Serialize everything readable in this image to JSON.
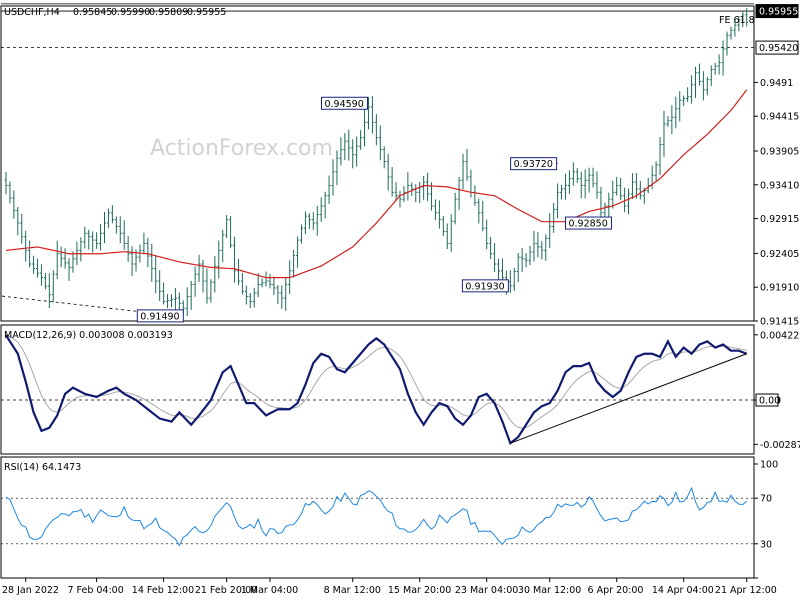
{
  "chart_data": [
    {
      "type": "candlestick",
      "header": {
        "symbol": "USDCHF,H4",
        "open": "0.95845",
        "high": "0.95990",
        "low": "0.95809",
        "close": "0.95955"
      },
      "watermark": "ActionForex.com",
      "y_axis": {
        "ylim": [
          0.91415,
          0.96
        ],
        "ticks": [
          "0.9491",
          "0.94415",
          "0.93905",
          "0.93410",
          "0.92915",
          "0.92405",
          "0.91910",
          "0.91415"
        ],
        "tick_values": [
          0.9491,
          0.94415,
          0.93905,
          0.9341,
          0.92915,
          0.92405,
          0.9191,
          0.91415
        ],
        "last_price_label": "0.95955",
        "last_price": 0.95955,
        "level_label": "0.95420",
        "level": 0.9542
      },
      "fib_label": "FE 61.8",
      "fib_level": 0.9606,
      "price_labels": [
        {
          "text": "0.94590",
          "value": 0.9459,
          "bar": 92
        },
        {
          "text": "0.93720",
          "value": 0.9372,
          "bar": 140
        },
        {
          "text": "0.92850",
          "value": 0.9285,
          "bar": 142
        },
        {
          "text": "0.91930",
          "value": 0.9193,
          "bar": 127
        },
        {
          "text": "0.91490",
          "value": 0.9149,
          "bar": 45
        }
      ],
      "keypoints": [
        [
          0,
          0.934
        ],
        [
          3,
          0.9285
        ],
        [
          6,
          0.9225
        ],
        [
          9,
          0.9205
        ],
        [
          11,
          0.918
        ],
        [
          13,
          0.924
        ],
        [
          16,
          0.922
        ],
        [
          20,
          0.927
        ],
        [
          23,
          0.9255
        ],
        [
          26,
          0.93
        ],
        [
          29,
          0.927
        ],
        [
          32,
          0.9225
        ],
        [
          35,
          0.9255
        ],
        [
          38,
          0.92
        ],
        [
          40,
          0.917
        ],
        [
          43,
          0.9175
        ],
        [
          45,
          0.916
        ],
        [
          47,
          0.9195
        ],
        [
          49,
          0.9225
        ],
        [
          51,
          0.9175
        ],
        [
          54,
          0.9245
        ],
        [
          56,
          0.929
        ],
        [
          58,
          0.9215
        ],
        [
          60,
          0.9185
        ],
        [
          62,
          0.917
        ],
        [
          64,
          0.9195
        ],
        [
          66,
          0.92
        ],
        [
          68,
          0.919
        ],
        [
          70,
          0.9175
        ],
        [
          72,
          0.9215
        ],
        [
          74,
          0.926
        ],
        [
          76,
          0.9295
        ],
        [
          78,
          0.9285
        ],
        [
          80,
          0.931
        ],
        [
          82,
          0.934
        ],
        [
          84,
          0.938
        ],
        [
          86,
          0.9405
        ],
        [
          88,
          0.9385
        ],
        [
          90,
          0.941
        ],
        [
          92,
          0.9455
        ],
        [
          94,
          0.941
        ],
        [
          96,
          0.9375
        ],
        [
          98,
          0.933
        ],
        [
          100,
          0.932
        ],
        [
          102,
          0.934
        ],
        [
          104,
          0.933
        ],
        [
          106,
          0.9345
        ],
        [
          108,
          0.931
        ],
        [
          110,
          0.929
        ],
        [
          112,
          0.9255
        ],
        [
          114,
          0.932
        ],
        [
          116,
          0.9375
        ],
        [
          118,
          0.933
        ],
        [
          120,
          0.93
        ],
        [
          122,
          0.9255
        ],
        [
          124,
          0.9225
        ],
        [
          126,
          0.9205
        ],
        [
          128,
          0.9193
        ],
        [
          130,
          0.9235
        ],
        [
          132,
          0.923
        ],
        [
          134,
          0.9255
        ],
        [
          136,
          0.9245
        ],
        [
          138,
          0.928
        ],
        [
          140,
          0.933
        ],
        [
          142,
          0.934
        ],
        [
          144,
          0.936
        ],
        [
          146,
          0.934
        ],
        [
          148,
          0.9355
        ],
        [
          150,
          0.933
        ],
        [
          151,
          0.93
        ],
        [
          153,
          0.932
        ],
        [
          155,
          0.934
        ],
        [
          157,
          0.931
        ],
        [
          159,
          0.9345
        ],
        [
          161,
          0.9325
        ],
        [
          163,
          0.934
        ],
        [
          165,
          0.937
        ],
        [
          167,
          0.943
        ],
        [
          169,
          0.944
        ],
        [
          171,
          0.9465
        ],
        [
          173,
          0.947
        ],
        [
          175,
          0.9505
        ],
        [
          177,
          0.948
        ],
        [
          179,
          0.951
        ],
        [
          181,
          0.952
        ],
        [
          183,
          0.956
        ],
        [
          185,
          0.9575
        ],
        [
          187,
          0.959
        ],
        [
          188,
          0.95955
        ]
      ],
      "ma_keypoints": [
        [
          0,
          0.9245
        ],
        [
          8,
          0.925
        ],
        [
          16,
          0.924
        ],
        [
          24,
          0.924
        ],
        [
          30,
          0.9243
        ],
        [
          36,
          0.924
        ],
        [
          44,
          0.9228
        ],
        [
          52,
          0.922
        ],
        [
          58,
          0.9218
        ],
        [
          66,
          0.9205
        ],
        [
          72,
          0.9205
        ],
        [
          80,
          0.9222
        ],
        [
          88,
          0.925
        ],
        [
          94,
          0.9285
        ],
        [
          100,
          0.9325
        ],
        [
          106,
          0.934
        ],
        [
          112,
          0.9338
        ],
        [
          118,
          0.933
        ],
        [
          124,
          0.9325
        ],
        [
          130,
          0.9305
        ],
        [
          136,
          0.9287
        ],
        [
          142,
          0.9287
        ],
        [
          148,
          0.9302
        ],
        [
          154,
          0.931
        ],
        [
          160,
          0.9325
        ],
        [
          166,
          0.935
        ],
        [
          172,
          0.9385
        ],
        [
          178,
          0.9415
        ],
        [
          184,
          0.945
        ],
        [
          188,
          0.948
        ]
      ],
      "x_axis": {
        "labels": [
          "28 Jan 2022",
          "7 Feb 04:00",
          "14 Feb 12:00",
          "21 Feb 20:00",
          "1 Mar 04:00",
          "8 Mar 12:00",
          "15 Mar 20:00",
          "23 Mar 04:00",
          "30 Mar 12:00",
          "6 Apr 20:00",
          "14 Apr 04:00",
          "21 Apr 12:00"
        ],
        "label_bars": [
          5,
          23,
          40,
          56,
          67,
          88,
          105,
          122,
          138,
          155,
          172,
          188
        ]
      }
    },
    {
      "type": "line",
      "title": "MACD(12,26,9) 0.003008 0.003193",
      "y_axis": {
        "ylim": [
          -0.0035,
          0.0048
        ],
        "ticks": [
          "0.004229",
          "0.00",
          "-0.002874"
        ],
        "tick_values": [
          0.004229,
          0.0,
          -0.002874
        ],
        "current_label": "0.00",
        "current_value": 0.0
      },
      "keypoints": [
        [
          0,
          0.0042
        ],
        [
          3,
          0.003
        ],
        [
          5,
          0.0012
        ],
        [
          7,
          -0.0008
        ],
        [
          9,
          -0.002
        ],
        [
          11,
          -0.0018
        ],
        [
          13,
          -0.001
        ],
        [
          15,
          0.0004
        ],
        [
          17,
          0.0008
        ],
        [
          20,
          0.0004
        ],
        [
          23,
          0.0002
        ],
        [
          26,
          0.0006
        ],
        [
          28,
          0.0008
        ],
        [
          30,
          0.0004
        ],
        [
          33,
          0.0
        ],
        [
          36,
          -0.0006
        ],
        [
          39,
          -0.0012
        ],
        [
          42,
          -0.0014
        ],
        [
          44,
          -0.0008
        ],
        [
          47,
          -0.0016
        ],
        [
          49,
          -0.001
        ],
        [
          52,
          0.0
        ],
        [
          55,
          0.0018
        ],
        [
          57,
          0.0022
        ],
        [
          59,
          0.001
        ],
        [
          61,
          -0.0002
        ],
        [
          63,
          -0.0002
        ],
        [
          66,
          -0.001
        ],
        [
          69,
          -0.0006
        ],
        [
          72,
          -0.0006
        ],
        [
          74,
          -0.0002
        ],
        [
          76,
          0.001
        ],
        [
          78,
          0.0024
        ],
        [
          80,
          0.003
        ],
        [
          82,
          0.0028
        ],
        [
          84,
          0.002
        ],
        [
          86,
          0.0018
        ],
        [
          88,
          0.0024
        ],
        [
          90,
          0.003
        ],
        [
          92,
          0.0036
        ],
        [
          94,
          0.004
        ],
        [
          96,
          0.0036
        ],
        [
          98,
          0.0028
        ],
        [
          100,
          0.002
        ],
        [
          102,
          0.0004
        ],
        [
          104,
          -0.0008
        ],
        [
          106,
          -0.0016
        ],
        [
          108,
          -0.0008
        ],
        [
          110,
          -0.0002
        ],
        [
          112,
          -0.0004
        ],
        [
          114,
          -0.0012
        ],
        [
          116,
          -0.0016
        ],
        [
          118,
          -0.001
        ],
        [
          120,
          0.0002
        ],
        [
          122,
          0.0004
        ],
        [
          124,
          -0.0002
        ],
        [
          126,
          -0.0014
        ],
        [
          128,
          -0.0028
        ],
        [
          130,
          -0.0024
        ],
        [
          132,
          -0.0016
        ],
        [
          134,
          -0.0008
        ],
        [
          136,
          -0.0004
        ],
        [
          138,
          -0.0002
        ],
        [
          140,
          0.0006
        ],
        [
          142,
          0.0018
        ],
        [
          144,
          0.0022
        ],
        [
          146,
          0.0022
        ],
        [
          148,
          0.0024
        ],
        [
          150,
          0.0012
        ],
        [
          152,
          0.0006
        ],
        [
          154,
          0.0002
        ],
        [
          156,
          0.0006
        ],
        [
          158,
          0.0018
        ],
        [
          160,
          0.0028
        ],
        [
          162,
          0.003
        ],
        [
          164,
          0.003
        ],
        [
          166,
          0.0028
        ],
        [
          168,
          0.0038
        ],
        [
          170,
          0.0028
        ],
        [
          172,
          0.0034
        ],
        [
          174,
          0.003
        ],
        [
          176,
          0.0036
        ],
        [
          178,
          0.0038
        ],
        [
          180,
          0.0034
        ],
        [
          182,
          0.0036
        ],
        [
          184,
          0.0032
        ],
        [
          186,
          0.0032
        ],
        [
          188,
          0.003
        ]
      ],
      "trendline": {
        "from": [
          128,
          -0.0028
        ],
        "to": [
          188,
          0.003
        ]
      }
    },
    {
      "type": "line",
      "title": "RSI(14) 64.1473",
      "y_axis": {
        "ylim": [
          0,
          100
        ],
        "ticks": [
          "100",
          "70",
          "30",
          "0"
        ],
        "tick_values": [
          100,
          70,
          30,
          0
        ]
      },
      "keypoints": [
        [
          0,
          70
        ],
        [
          2,
          62
        ],
        [
          4,
          48
        ],
        [
          6,
          38
        ],
        [
          8,
          32
        ],
        [
          10,
          42
        ],
        [
          12,
          48
        ],
        [
          14,
          58
        ],
        [
          16,
          55
        ],
        [
          18,
          60
        ],
        [
          20,
          56
        ],
        [
          22,
          52
        ],
        [
          24,
          60
        ],
        [
          26,
          54
        ],
        [
          28,
          52
        ],
        [
          30,
          60
        ],
        [
          32,
          54
        ],
        [
          34,
          48
        ],
        [
          36,
          44
        ],
        [
          38,
          50
        ],
        [
          40,
          40
        ],
        [
          42,
          36
        ],
        [
          44,
          30
        ],
        [
          46,
          36
        ],
        [
          48,
          44
        ],
        [
          50,
          38
        ],
        [
          52,
          48
        ],
        [
          54,
          60
        ],
        [
          56,
          66
        ],
        [
          58,
          54
        ],
        [
          60,
          42
        ],
        [
          62,
          44
        ],
        [
          64,
          50
        ],
        [
          66,
          38
        ],
        [
          68,
          44
        ],
        [
          70,
          40
        ],
        [
          72,
          46
        ],
        [
          74,
          54
        ],
        [
          76,
          62
        ],
        [
          78,
          66
        ],
        [
          80,
          60
        ],
        [
          82,
          58
        ],
        [
          84,
          68
        ],
        [
          86,
          72
        ],
        [
          88,
          64
        ],
        [
          90,
          70
        ],
        [
          92,
          76
        ],
        [
          94,
          72
        ],
        [
          96,
          62
        ],
        [
          98,
          54
        ],
        [
          100,
          44
        ],
        [
          102,
          40
        ],
        [
          104,
          44
        ],
        [
          106,
          50
        ],
        [
          108,
          46
        ],
        [
          110,
          52
        ],
        [
          112,
          46
        ],
        [
          114,
          56
        ],
        [
          116,
          62
        ],
        [
          118,
          50
        ],
        [
          120,
          44
        ],
        [
          122,
          40
        ],
        [
          124,
          36
        ],
        [
          126,
          32
        ],
        [
          128,
          36
        ],
        [
          130,
          40
        ],
        [
          132,
          44
        ],
        [
          134,
          42
        ],
        [
          136,
          48
        ],
        [
          138,
          54
        ],
        [
          140,
          62
        ],
        [
          142,
          64
        ],
        [
          144,
          66
        ],
        [
          146,
          62
        ],
        [
          148,
          72
        ],
        [
          150,
          58
        ],
        [
          152,
          48
        ],
        [
          154,
          54
        ],
        [
          156,
          48
        ],
        [
          158,
          54
        ],
        [
          160,
          60
        ],
        [
          162,
          70
        ],
        [
          164,
          66
        ],
        [
          166,
          72
        ],
        [
          168,
          64
        ],
        [
          170,
          72
        ],
        [
          172,
          66
        ],
        [
          174,
          76
        ],
        [
          176,
          62
        ],
        [
          178,
          68
        ],
        [
          180,
          72
        ],
        [
          182,
          66
        ],
        [
          184,
          72
        ],
        [
          186,
          62
        ],
        [
          188,
          64
        ]
      ]
    }
  ]
}
